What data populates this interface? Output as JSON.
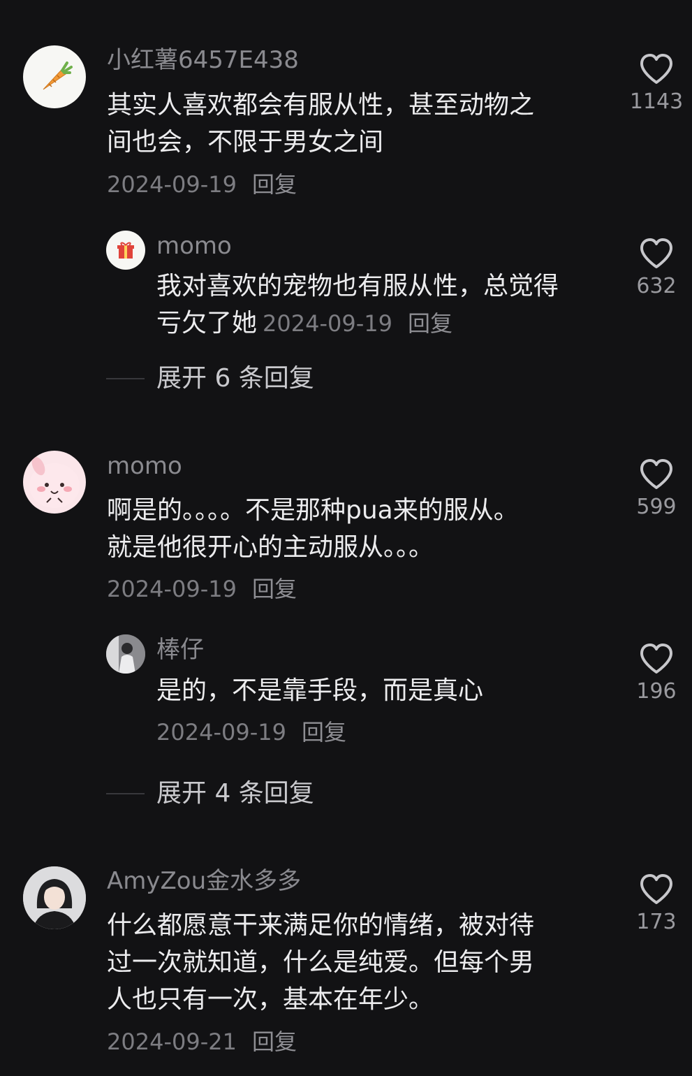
{
  "comments": [
    {
      "username": "小红薯6457E438",
      "avatar_icon": "carrot-icon",
      "text": "其实人喜欢都会有服从性，甚至动物之\n间也会，不限于男女之间",
      "date": "2024-09-19",
      "reply_label": "回复",
      "likes": "1143",
      "reply": {
        "username": "momo",
        "avatar_icon": "gift-icon",
        "text": "我对喜欢的宠物也有服从性，总觉得\n亏欠了她",
        "date": "2024-09-19",
        "reply_label": "回复",
        "likes": "632"
      },
      "expand_label": "展开 6 条回复"
    },
    {
      "username": "momo",
      "avatar_icon": "pink-bunny-icon",
      "text": "啊是的。。。。不是那种pua来的服从。\n就是他很开心的主动服从。。。",
      "date": "2024-09-19",
      "reply_label": "回复",
      "likes": "599",
      "reply": {
        "username": "棒仔",
        "avatar_icon": "photo-avatar-icon",
        "text": "是的，不是靠手段，而是真心",
        "date": "2024-09-19",
        "reply_label": "回复",
        "likes": "196"
      },
      "expand_label": "展开 4 条回复"
    },
    {
      "username": "AmyZou金水多多",
      "avatar_icon": "portrait-avatar-icon",
      "text": "什么都愿意干来满足你的情绪，被对待\n过一次就知道，什么是纯爱。但每个男\n人也只有一次，基本在年少。",
      "date": "2024-09-21",
      "reply_label": "回复",
      "likes": "173"
    }
  ],
  "colors": {
    "background": "#121214",
    "text": "#ececee",
    "secondary": "#8a8a8f",
    "heart": "#c7c7cb"
  }
}
